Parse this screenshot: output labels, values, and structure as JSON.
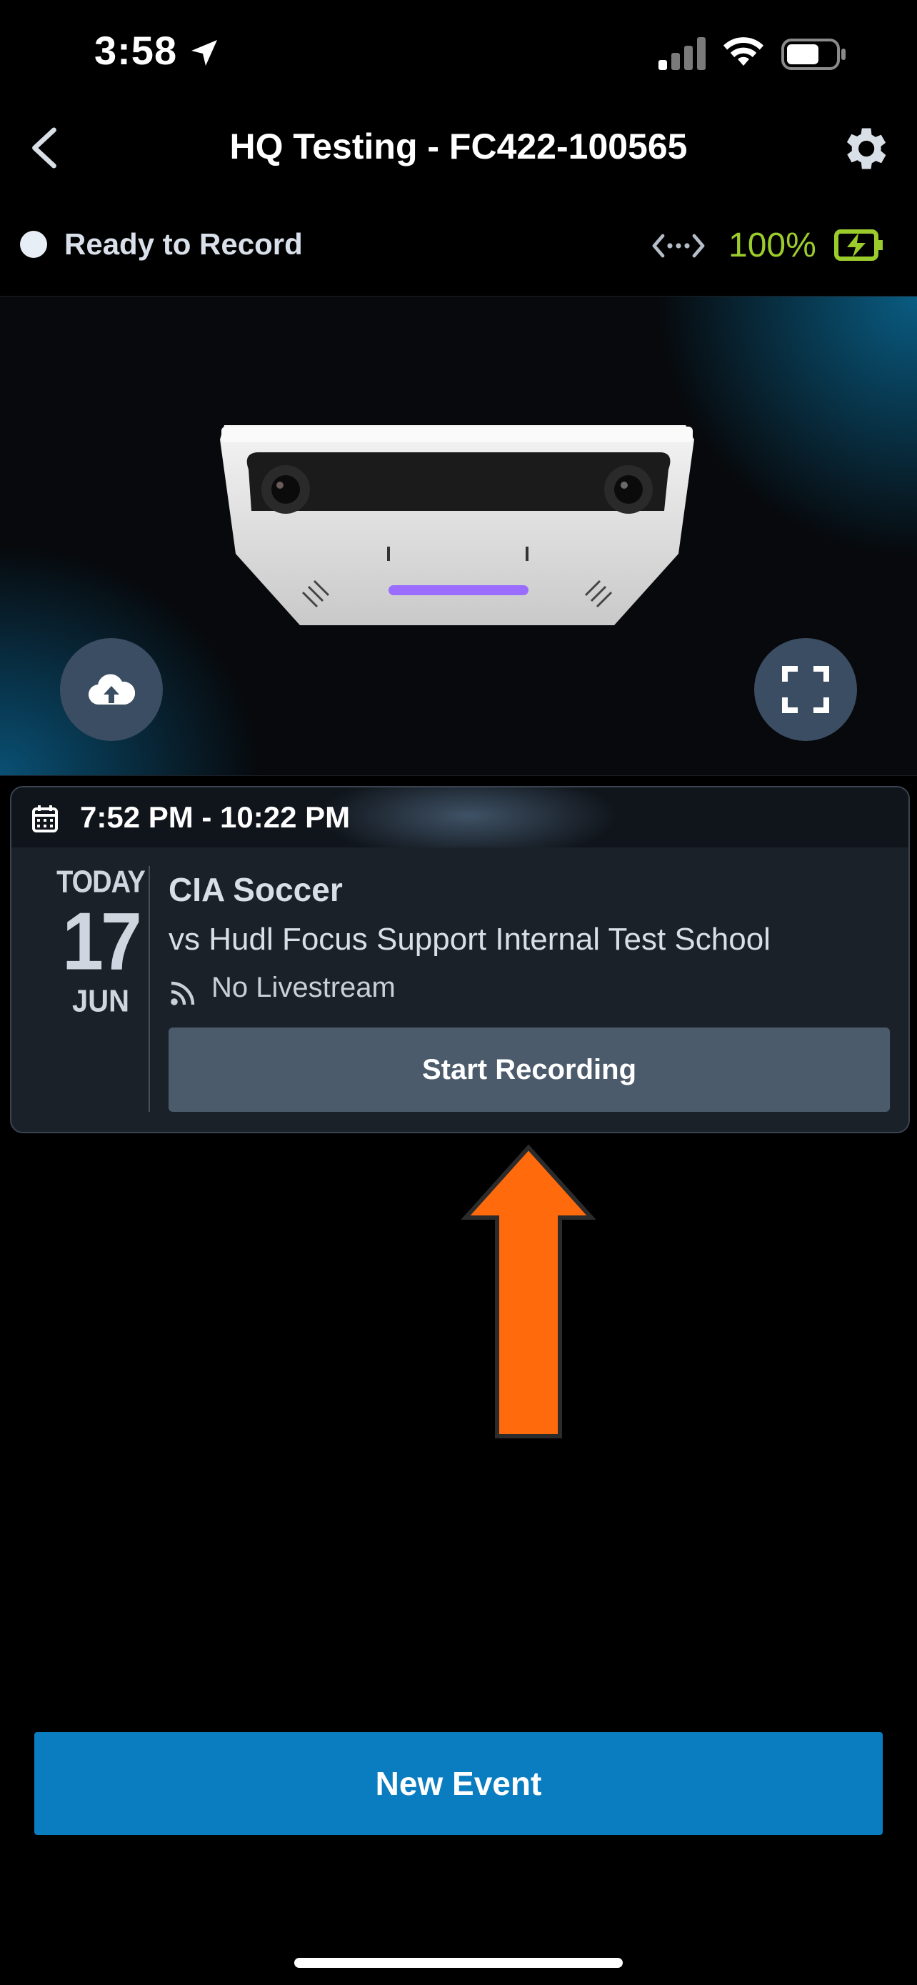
{
  "status_bar": {
    "time": "3:58"
  },
  "nav": {
    "title": "HQ Testing - FC422-100565"
  },
  "device_status": {
    "state": "Ready to Record",
    "battery_percent": "100%",
    "accent_color": "#9ccc2c"
  },
  "event_card": {
    "time_range": "7:52 PM - 10:22 PM",
    "date": {
      "label": "TODAY",
      "day": "17",
      "month": "JUN"
    },
    "title": "CIA Soccer",
    "opponent": "vs Hudl Focus Support Internal Test School",
    "livestream": "No Livestream",
    "primary_action": "Start Recording"
  },
  "footer": {
    "new_event_label": "New Event",
    "brand_color": "#0a7cc0"
  },
  "annotation": {
    "arrow_color": "#ff6a0d"
  },
  "icons": [
    "location-arrow-icon",
    "signal-icon",
    "wifi-icon",
    "battery-icon",
    "back-chevron-icon",
    "gear-icon",
    "connection-icon",
    "charging-icon",
    "camera-image",
    "cloud-upload-icon",
    "fullscreen-icon",
    "calendar-icon",
    "rss-icon",
    "arrow-annotation"
  ]
}
